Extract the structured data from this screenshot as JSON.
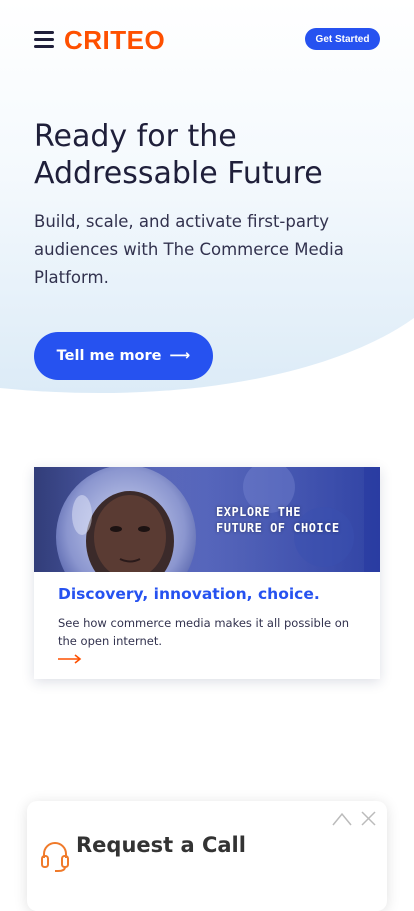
{
  "header": {
    "logo_text": "CRITEO",
    "cta_label": "Get Started"
  },
  "hero": {
    "title": "Ready for the Addressable Future",
    "text": "Build, scale, and activate first-party audiences with The Commerce Media Platform.",
    "button_label": "Tell me more",
    "button_arrow": "⟶"
  },
  "card": {
    "image_text": "EXPLORE THE\nFUTURE OF CHOICE",
    "title": "Discovery, innovation, choice.",
    "text": "See how commerce media makes it all possible on the open internet."
  },
  "call_widget": {
    "title": "Request a Call"
  },
  "colors": {
    "brand_orange": "#fe5000",
    "accent_blue": "#2652f0",
    "text_dark": "#1f1f3a"
  },
  "icons": [
    "menu-icon",
    "arrow-right-icon",
    "headset-icon",
    "chevron-up-icon",
    "close-icon"
  ]
}
